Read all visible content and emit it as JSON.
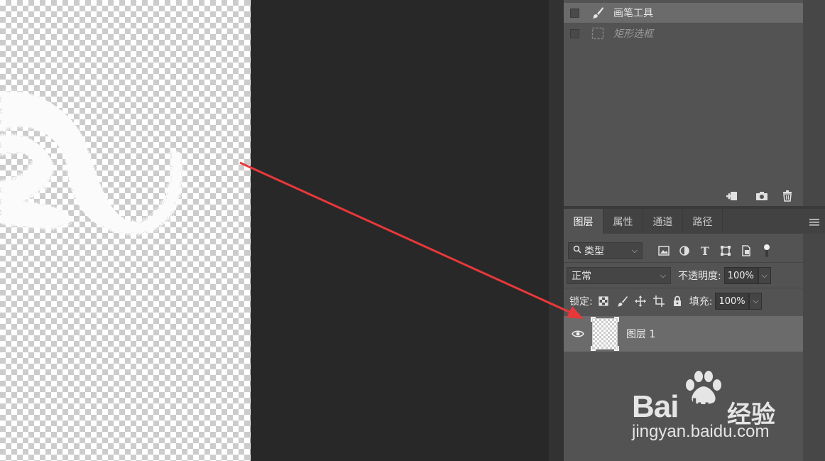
{
  "history": {
    "items": [
      {
        "label": "画笔工具",
        "icon": "brush-icon",
        "selected": true
      },
      {
        "label": "矩形选框",
        "icon": "marquee-icon",
        "selected": false
      }
    ]
  },
  "layers_panel": {
    "tabs": [
      "图层",
      "属性",
      "通道",
      "路径"
    ],
    "filter_select": "类型",
    "blend_mode": "正常",
    "opacity_label": "不透明度:",
    "opacity_value": "100%",
    "lock_label": "锁定:",
    "fill_label": "填充:",
    "fill_value": "100%",
    "layers": [
      {
        "name": "图层 1",
        "visible": true
      }
    ]
  },
  "watermark": {
    "brand_left": "Bai",
    "brand_right": "du",
    "brand_cn": "经验",
    "url": "jingyan.baidu.com"
  },
  "colors": {
    "arrow": "#e8383a",
    "panel_bg": "#535353",
    "selected_row": "#6b6b6b",
    "pasteboard": "#282828"
  }
}
